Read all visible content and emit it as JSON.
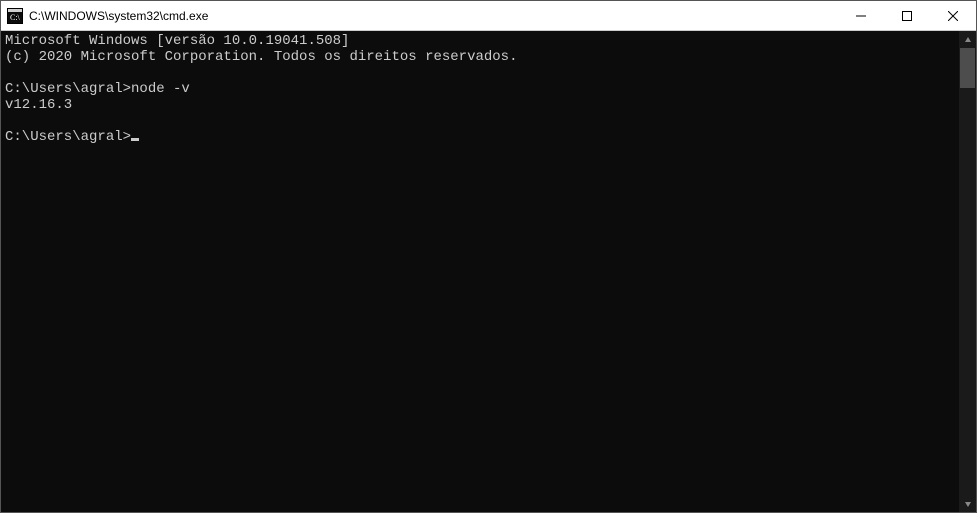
{
  "window": {
    "title": "C:\\WINDOWS\\system32\\cmd.exe"
  },
  "terminal": {
    "lines": [
      "Microsoft Windows [versão 10.0.19041.508]",
      "(c) 2020 Microsoft Corporation. Todos os direitos reservados.",
      "",
      "C:\\Users\\agral>node -v",
      "v12.16.3",
      "",
      "C:\\Users\\agral>"
    ],
    "prompt_path": "C:\\Users\\agral",
    "last_command": "node -v",
    "last_output": "v12.16.3"
  }
}
